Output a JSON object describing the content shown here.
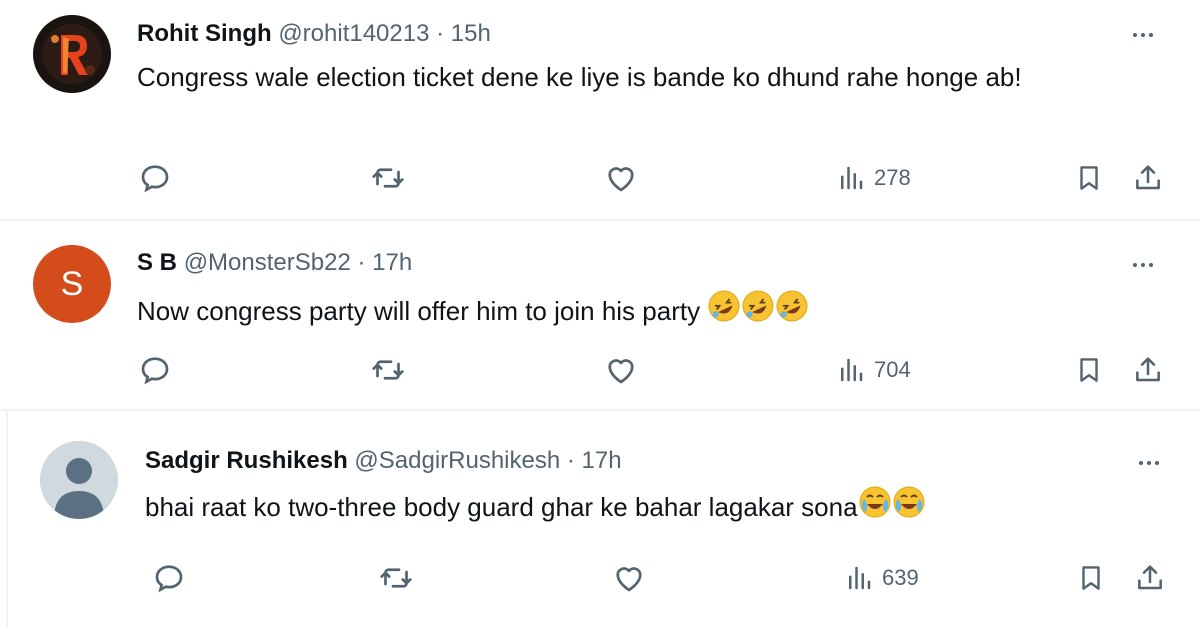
{
  "tweets": [
    {
      "name": "Rohit Singh",
      "handle": "@rohit140213",
      "separator": "·",
      "time": "15h",
      "text": "Congress wale election ticket dene ke liye is bande ko dhund rahe honge ab!",
      "views": "278",
      "avatar_initial": ""
    },
    {
      "name": "S B",
      "handle": "@MonsterSb22",
      "separator": "·",
      "time": "17h",
      "text": "Now congress party will offer him to join his party",
      "emoji": "rolling-on-floor-laughing x3",
      "views": "704",
      "avatar_initial": "S"
    },
    {
      "name": "Sadgir Rushikesh",
      "handle": "@SadgirRushikesh",
      "separator": "·",
      "time": "17h",
      "text": "bhai raat ko two-three body guard ghar ke bahar lagakar sona",
      "emoji": "face-with-tears-of-joy x2",
      "views": "639",
      "avatar_initial": ""
    }
  ],
  "icons": {
    "reply": "reply-icon",
    "retweet": "retweet-icon",
    "like": "heart-icon",
    "views": "views-icon",
    "bookmark": "bookmark-icon",
    "share": "share-icon",
    "more": "more-icon"
  },
  "colors": {
    "text": "#0f1419",
    "secondary": "#536471",
    "divider": "#eff3f4",
    "avatar_sb": "#d44b1c",
    "avatar_default": "#cfd9de"
  }
}
